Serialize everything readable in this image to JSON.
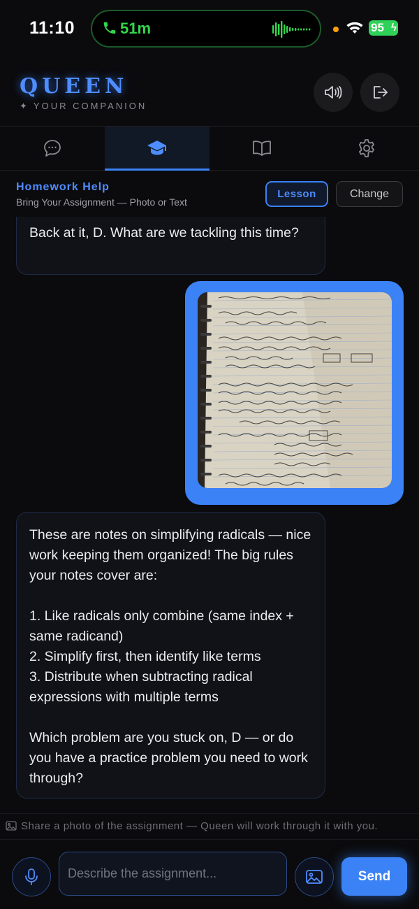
{
  "status_bar": {
    "time": "11:10",
    "call_duration": "51m",
    "battery": "95"
  },
  "header": {
    "brand": "QUEEN",
    "tagline": "YOUR COMPANION",
    "tagline_icon": "sparkle-icon",
    "buttons": [
      {
        "name": "sound",
        "icon": "speaker-icon"
      },
      {
        "name": "logout",
        "icon": "logout-icon"
      }
    ]
  },
  "tabs": [
    {
      "name": "chat",
      "icon": "chat-bubble-icon",
      "active": false
    },
    {
      "name": "homework",
      "icon": "graduation-cap-icon",
      "active": true
    },
    {
      "name": "journal",
      "icon": "book-icon",
      "active": false
    },
    {
      "name": "settings",
      "icon": "gear-icon",
      "active": false
    }
  ],
  "mode": {
    "title": "Homework Help",
    "subtitle": "Bring Your Assignment — Photo or Text",
    "lesson_label": "Lesson",
    "change_label": "Change"
  },
  "messages": [
    {
      "from": "assistant",
      "text": "Back at it, D. What are we tackling this time?"
    },
    {
      "from": "user",
      "type": "photo",
      "description": "notebook page with handwritten radical notes"
    },
    {
      "from": "assistant",
      "text": "These are notes on simplifying radicals — nice work keeping them organized! The big rules your notes cover are:\n\n1. Like radicals only combine (same index + same radicand)\n2. Simplify first, then identify like terms\n3. Distribute when subtracting radical expressions with multiple terms\n\nWhich problem are you stuck on, D — or do you have a practice problem you need to work through?"
    }
  ],
  "hint": "Share a photo of the assignment — Queen will work through it with you.",
  "composer": {
    "placeholder": "Describe the assignment...",
    "send_label": "Send"
  },
  "colors": {
    "accent": "#3b82f6",
    "background": "#0b0b0d",
    "call_green": "#32d74b",
    "battery_green": "#30d158"
  }
}
